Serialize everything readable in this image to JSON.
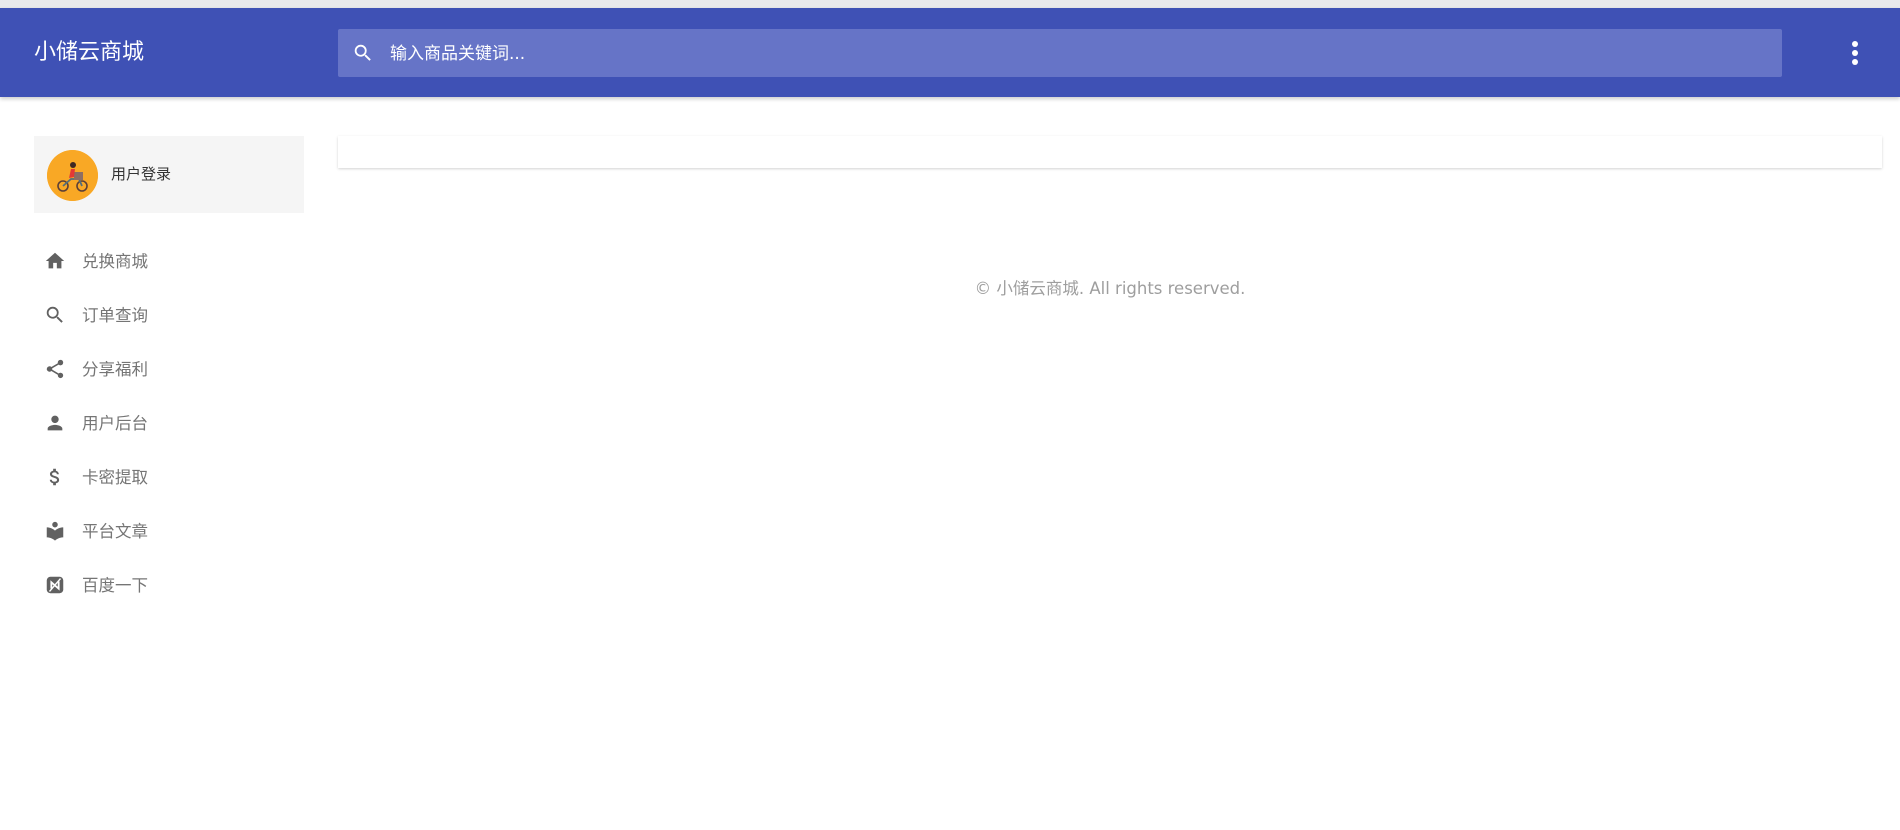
{
  "app": {
    "title": "小储云商城",
    "brand_color": "#3f51b5"
  },
  "search": {
    "placeholder": "输入商品关键词...",
    "value": "",
    "icon": "search-icon"
  },
  "header": {
    "more_icon": "more-vertical-icon"
  },
  "profile": {
    "login_label": "用户登录",
    "avatar_color": "#f9a825"
  },
  "sidebar": {
    "items": [
      {
        "label": "兑换商城",
        "icon": "home-icon"
      },
      {
        "label": "订单查询",
        "icon": "search-icon"
      },
      {
        "label": "分享福利",
        "icon": "share-icon"
      },
      {
        "label": "用户后台",
        "icon": "person-icon"
      },
      {
        "label": "卡密提取",
        "icon": "dollar-icon"
      },
      {
        "label": "平台文章",
        "icon": "book-icon"
      },
      {
        "label": "百度一下",
        "icon": "baidu-icon"
      }
    ]
  },
  "footer": {
    "copyright": "© 小储云商城. All rights reserved."
  }
}
